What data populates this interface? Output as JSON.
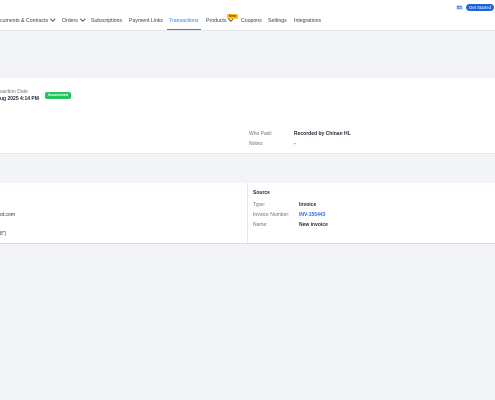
{
  "nav": {
    "tabs": [
      {
        "label": "cuments & Contracts",
        "has_chevron": true
      },
      {
        "label": "Orders",
        "has_chevron": true
      },
      {
        "label": "Subscriptions"
      },
      {
        "label": "Payment Links"
      },
      {
        "label": "Transactions",
        "active": true
      },
      {
        "label": "Products",
        "has_chevron": true,
        "badge": "New"
      },
      {
        "label": "Coupons"
      },
      {
        "label": "Settings"
      },
      {
        "label": "Integrations"
      }
    ],
    "get_started_label": "Get Started",
    "mail_icon": "mail-icon"
  },
  "transaction": {
    "date_label": "saction Date",
    "date_value": "ug 2025 4:14 PM",
    "status": "Succeeded",
    "who_paid_label": "Who Paid:",
    "who_paid_value": "Recorded by Chinan HL",
    "notes_label": "Notes:",
    "notes_value": "-"
  },
  "customer": {
    "email_fragment": "ot.com",
    "address_fragment": "8\")"
  },
  "source": {
    "title": "Source",
    "type_label": "Type:",
    "type_value": "Invoice",
    "invoice_number_label": "Invoice Number:",
    "invoice_number_value": "INV-155443",
    "name_label": "Name:",
    "name_value": "New invoice"
  },
  "colors": {
    "accent": "#2d7ff9",
    "success": "#22c55e",
    "badge_new": "#fbbf24",
    "primary_button": "#1e63d6"
  }
}
